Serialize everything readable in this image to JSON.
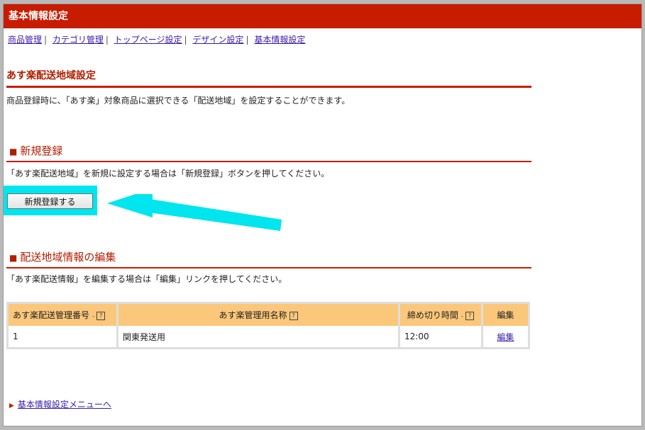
{
  "title": "基本情報設定",
  "nav": [
    "商品管理",
    "カテゴリ管理",
    "トップページ設定",
    "デザイン設定",
    "基本情報設定"
  ],
  "nav_sep": "|",
  "page_heading": "あす楽配送地域設定",
  "page_desc": "商品登録時に、「あす楽」対象商品に選択できる「配送地域」を設定することができます。",
  "new_section": {
    "heading": "新規登録",
    "marker": "■",
    "desc": "「あす楽配送地域」を新規に設定する場合は「新規登録」ボタンを押してください。",
    "button": "新規登録する"
  },
  "edit_section": {
    "heading": "配送地域情報の編集",
    "marker": "■",
    "desc": "「あす楽配送情報」を編集する場合は「編集」リンクを押してください。"
  },
  "table": {
    "headers": [
      "あす楽配送管理番号",
      "あす楽管理用名称",
      "締め切り時間",
      "編集"
    ],
    "help_glyph": "?",
    "rows": [
      {
        "id": "1",
        "name": "関東発送用",
        "deadline": "12:00",
        "edit": "編集"
      }
    ]
  },
  "footer_link": "基本情報設定メニューへ",
  "colors": {
    "accent": "#c81c00",
    "highlight": "#00e5ee",
    "header_bg": "#fbc77a",
    "link": "#3a1ca8"
  }
}
